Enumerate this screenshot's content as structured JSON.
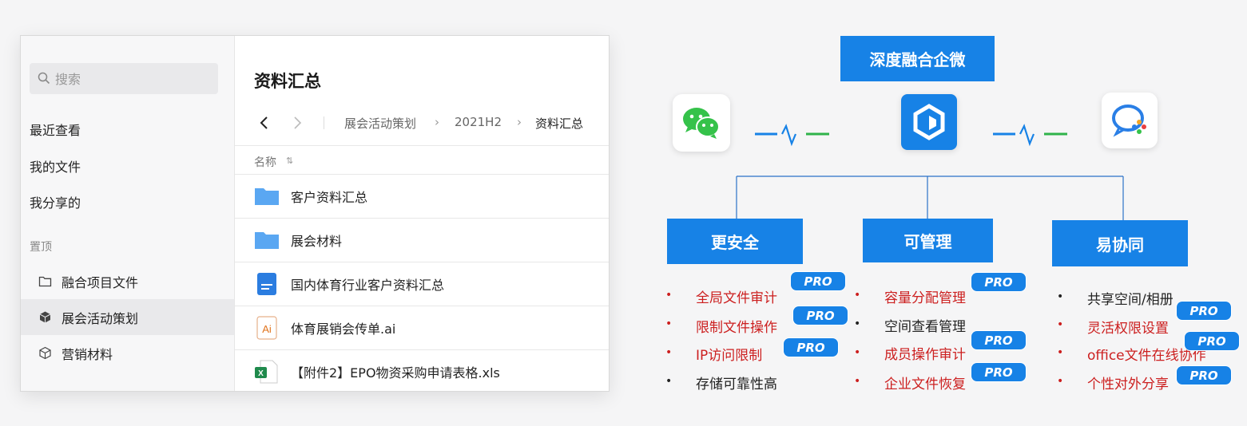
{
  "left_app": {
    "search": {
      "placeholder": "搜索"
    },
    "nav": [
      "最近查看",
      "我的文件",
      "我分享的"
    ],
    "pinned_section": "置顶",
    "pinned": [
      {
        "label": "融合项目文件",
        "icon": "folder-outline-icon"
      },
      {
        "label": "展会活动策划",
        "icon": "cube-solid-icon",
        "selected": true
      },
      {
        "label": "营销材料",
        "icon": "cube-outline-icon"
      }
    ],
    "title": "资料汇总",
    "breadcrumb": [
      "展会活动策划",
      "2021H2",
      "资料汇总"
    ],
    "column_name": "名称",
    "files": [
      {
        "name": "客户资料汇总",
        "icon": "folder-icon"
      },
      {
        "name": "展会材料",
        "icon": "folder-icon"
      },
      {
        "name": "国内体育行业客户资料汇总",
        "icon": "document-icon"
      },
      {
        "name": "体育展销会传单.ai",
        "icon": "ai-file-icon"
      },
      {
        "name": "【附件2】EPO物资采购申请表格.xls",
        "icon": "excel-file-icon"
      }
    ]
  },
  "diagram": {
    "top_label": "深度融合企微",
    "pillars": [
      {
        "title": "更安全",
        "items": [
          {
            "text": "全局文件审计",
            "pro": true,
            "color": "red"
          },
          {
            "text": "限制文件操作",
            "pro": true,
            "color": "red"
          },
          {
            "text": "IP访问限制",
            "pro": true,
            "color": "red"
          },
          {
            "text": "存储可靠性高",
            "pro": false,
            "color": "black"
          }
        ]
      },
      {
        "title": "可管理",
        "items": [
          {
            "text": "容量分配管理",
            "pro": true,
            "color": "red"
          },
          {
            "text": "空间查看管理",
            "pro": false,
            "color": "black"
          },
          {
            "text": "成员操作审计",
            "pro": true,
            "color": "red"
          },
          {
            "text": "企业文件恢复",
            "pro": true,
            "color": "red"
          }
        ]
      },
      {
        "title": "易协同",
        "items": [
          {
            "text": "共享空间/相册",
            "pro": false,
            "color": "black"
          },
          {
            "text": "灵活权限设置",
            "pro": true,
            "color": "red"
          },
          {
            "text": "office文件在线协作",
            "pro": true,
            "color": "red"
          },
          {
            "text": "个性对外分享",
            "pro": true,
            "color": "red"
          }
        ]
      }
    ],
    "pro_label": "PRO",
    "bullet": "•",
    "colors": {
      "brand_blue": "#1782e6",
      "feature_red": "#cc1f1f",
      "link_green": "#2fb34a"
    }
  }
}
